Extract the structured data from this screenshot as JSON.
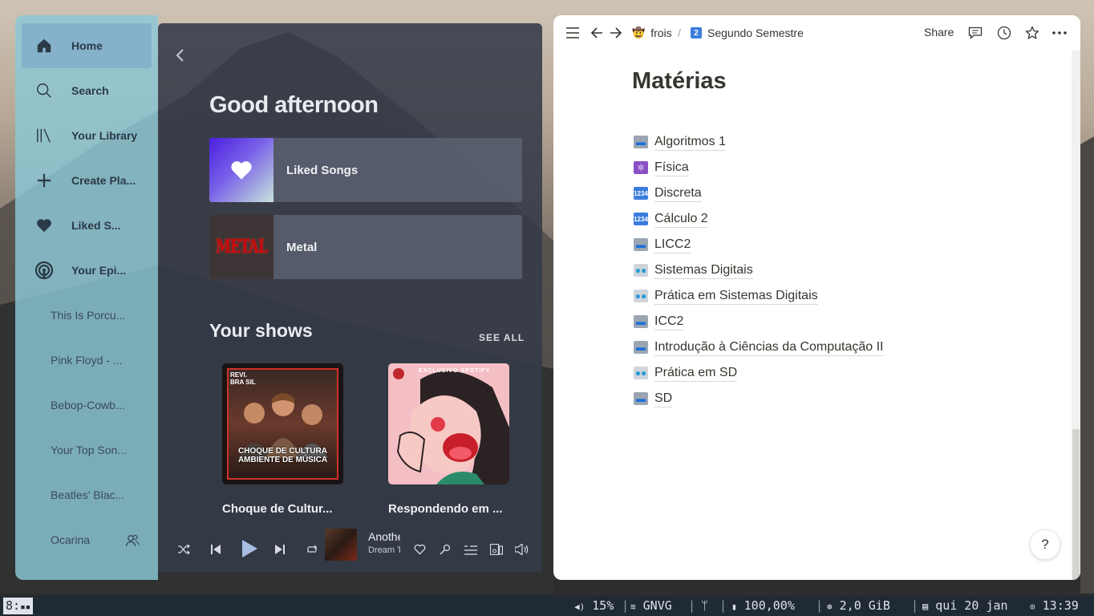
{
  "spotify": {
    "nav": [
      {
        "label": "Home",
        "icon": "home-icon"
      },
      {
        "label": "Search",
        "icon": "search-icon"
      },
      {
        "label": "Your Library",
        "icon": "library-icon"
      },
      {
        "label": "Create Pla...",
        "icon": "plus-icon"
      },
      {
        "label": "Liked S...",
        "icon": "heart-icon"
      },
      {
        "label": "Your Epi...",
        "icon": "podcast-icon"
      }
    ],
    "playlists": [
      "This Is Porcu...",
      "Pink Floyd - ...",
      "Bebop-Cowb...",
      "Your Top Son...",
      "Beatles' Blac...",
      "Ocarina"
    ],
    "greeting": "Good afternoon",
    "quick_cards": [
      {
        "name": "Liked Songs"
      },
      {
        "name": "Metal",
        "art_text": "METAL"
      }
    ],
    "shows_title": "Your shows",
    "see_all": "SEE ALL",
    "shows": [
      {
        "title": "Choque de Cultur...",
        "art_header": "REVI. BRA SIL",
        "art_text": "CHOQUE DE CULTURA AMBIENTE DE MÚSICA"
      },
      {
        "title": "Respondendo em ...",
        "art_header": "EXCLUSIVO SPOTIFY"
      }
    ],
    "player": {
      "track": "Anothe",
      "artist": "Dream T"
    }
  },
  "notion": {
    "breadcrumb": [
      {
        "emoji": "🤠",
        "label": "frois"
      },
      {
        "emoji": "2️⃣",
        "label": "Segundo Semestre"
      }
    ],
    "breadcrumb_sep": "/",
    "share": "Share",
    "title": "Matérias",
    "items": [
      {
        "emoji": "💻",
        "kind": "laptop",
        "label": "Algoritmos 1"
      },
      {
        "emoji": "⚛",
        "kind": "atom",
        "label": "Física"
      },
      {
        "emoji": "1234",
        "kind": "num",
        "label": "Discreta"
      },
      {
        "emoji": "1234",
        "kind": "num",
        "label": "Cálculo 2"
      },
      {
        "emoji": "💻",
        "kind": "laptop",
        "label": "LICC2"
      },
      {
        "emoji": "🤖",
        "kind": "robot",
        "label": "Sistemas Digitais"
      },
      {
        "emoji": "🤖",
        "kind": "robot",
        "label": "Prática em Sistemas Digitais"
      },
      {
        "emoji": "💻",
        "kind": "laptop",
        "label": "ICC2"
      },
      {
        "emoji": "💻",
        "kind": "laptop",
        "label": "Introdução à Ciências da Computação II"
      },
      {
        "emoji": "🤖",
        "kind": "robot",
        "label": "Prática em SD"
      },
      {
        "emoji": "💻",
        "kind": "laptop",
        "label": "SD"
      }
    ],
    "help": "?"
  },
  "statusbar": {
    "workspace": "8:",
    "volume": "15%",
    "wifi": "GNVG",
    "battery": "100,00%",
    "memory": "2,0 GiB",
    "date": "qui 20 jan",
    "time": "13:39"
  }
}
